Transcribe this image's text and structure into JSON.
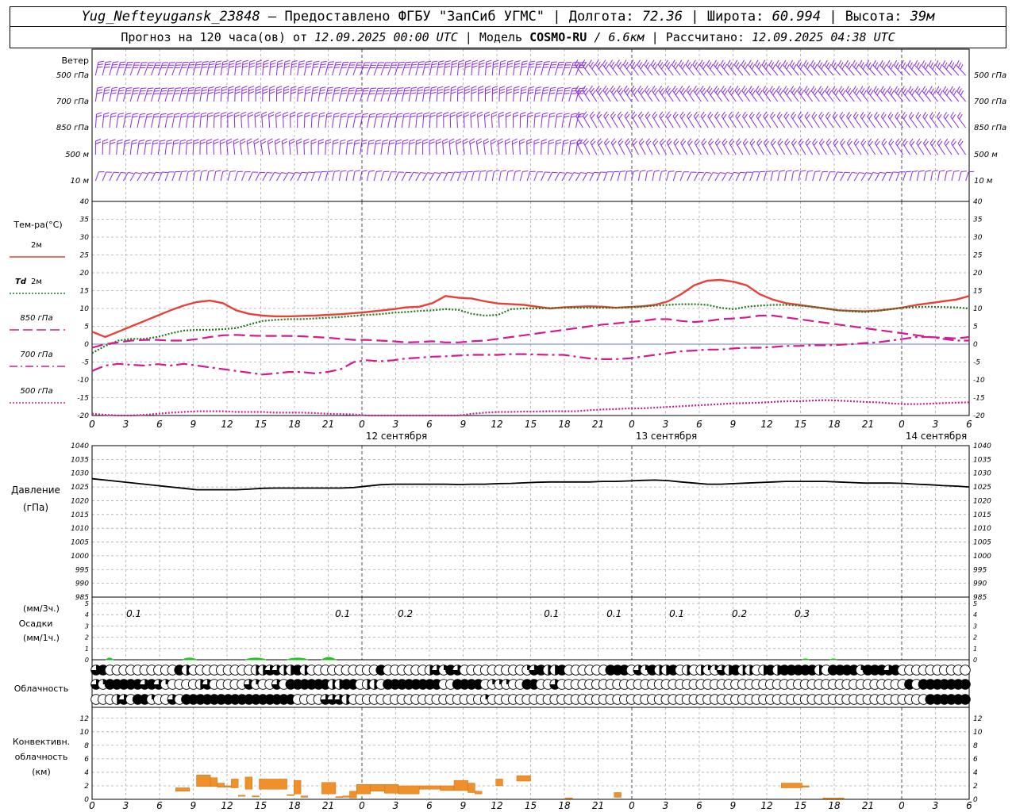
{
  "header": {
    "station": "Yug_Nefteyugansk_23848",
    "provider": "– Предоставлено ФГБУ \"ЗапСиб УГМС\"",
    "lon_label": "Долгота:",
    "lon_value": "72.36",
    "lat_label": "Широта:",
    "lat_value": "60.994",
    "alt_label": "Высота:",
    "alt_value": "39м",
    "forecast_prefix": "Прогноз на 120 часа(ов) от",
    "forecast_start": "12.09.2025 00:00 UTC",
    "model_label": "Модель",
    "model_name": "COSMO-RU",
    "model_res": "/ 6.6км",
    "calc_label": "Рассчитано:",
    "calc_time": "12.09.2025 04:38 UTC"
  },
  "hour_ticks": [
    "0",
    "3",
    "6",
    "9",
    "12",
    "15",
    "18",
    "21",
    "0",
    "3",
    "6",
    "9",
    "12",
    "15",
    "18",
    "21",
    "0",
    "3",
    "6",
    "9",
    "12",
    "15",
    "18",
    "21",
    "0",
    "3",
    "6"
  ],
  "day_labels": [
    {
      "index": 9,
      "text": "12 сентября"
    },
    {
      "index": 17,
      "text": "13 сентября"
    },
    {
      "index": 25,
      "text": "14 сентября"
    }
  ],
  "wind_panel": {
    "title": "Ветер",
    "levels": [
      "500 гПа",
      "700 гПа",
      "850 гПа",
      "500 м",
      "10 м"
    ],
    "barb_color": "#8a2be2"
  },
  "chart_data": [
    {
      "type": "line",
      "name": "temperature",
      "title": "Тем-ра(°C)",
      "x_hours": [
        0,
        3,
        6,
        9,
        12,
        15,
        18,
        21,
        24,
        27,
        30,
        33,
        36,
        39,
        42,
        45,
        48,
        51,
        54,
        57,
        60,
        63,
        66,
        69,
        72,
        75,
        78,
        81,
        84,
        87,
        90,
        93,
        96,
        99,
        102,
        105,
        108,
        111,
        114,
        117,
        120,
        123,
        126
      ],
      "ylim": [
        -20,
        40
      ],
      "yticks": [
        -20,
        -15,
        -10,
        -5,
        0,
        5,
        10,
        15,
        20,
        25,
        30,
        35,
        40
      ],
      "series": [
        {
          "name": "2м",
          "color": "#e8413a",
          "dash": "solid",
          "values": [
            3.5,
            2,
            3.5,
            5,
            6.5,
            8,
            9.5,
            10.8,
            11.8,
            12.2,
            11.5,
            9.5,
            8.5,
            8,
            7.8,
            7.8,
            7.9,
            8,
            8.2,
            8.4,
            8.7,
            9,
            9.4,
            9.8,
            10.3,
            10.5,
            11.5,
            13.5,
            13,
            12.8,
            12,
            11.4,
            11.2,
            11,
            10.5,
            10,
            10.3,
            10.5,
            10.6,
            10.5,
            10.2,
            10.4,
            10.6,
            11,
            12,
            14,
            16.5,
            17.8,
            18,
            17.5,
            16.5,
            14,
            12.5,
            11.5,
            11,
            10.5,
            10,
            9.5,
            9.3,
            9.2,
            9.4,
            9.8,
            10.3,
            11,
            11.5,
            12,
            12.5,
            13.5
          ]
        },
        {
          "name": "Td 2м",
          "color": "#1e7a1e",
          "dash": "dot",
          "values": [
            -2.5,
            -0.5,
            1,
            1.5,
            1.5,
            2,
            3,
            3.8,
            4,
            4,
            4.2,
            4.5,
            5.5,
            6.5,
            6.8,
            7,
            7,
            7.2,
            7.4,
            7.6,
            7.9,
            8.2,
            8.4,
            8.8,
            9,
            9.3,
            9.5,
            9.8,
            9.6,
            8.5,
            8,
            8.2,
            9.8,
            10,
            10,
            10.1,
            10.2,
            10.2,
            10.2,
            10.2,
            10.2,
            10.3,
            10.5,
            10.8,
            11,
            11.2,
            11.2,
            11,
            10.2,
            9.8,
            10.5,
            10.8,
            11,
            11,
            10.8,
            10.5,
            10,
            9.5,
            9.2,
            9,
            9.3,
            9.8,
            10.2,
            10.4,
            10.5,
            10.4,
            10.3,
            10
          ]
        },
        {
          "name": "850 гПа",
          "color": "#d21b8f",
          "dash": "longdash",
          "values": [
            -1,
            0,
            0.5,
            1,
            1.2,
            1.2,
            1,
            1,
            1.4,
            2,
            2.5,
            2.6,
            2.4,
            2.3,
            2.3,
            2.3,
            2.2,
            2,
            1.8,
            1.5,
            1.2,
            1.2,
            1,
            0.8,
            0.5,
            0.6,
            0.8,
            0.5,
            0.5,
            0.8,
            1,
            1.5,
            2,
            2.5,
            3,
            3.5,
            4,
            4.5,
            5,
            5.5,
            5.8,
            6.2,
            6.5,
            7,
            7,
            6.5,
            6.2,
            6.5,
            7,
            7.2,
            7.5,
            8,
            8,
            7.5,
            7,
            6.5,
            6,
            5.5,
            5,
            4.5,
            4,
            3.5,
            3,
            2.5,
            2,
            1.8,
            1.6,
            2
          ]
        },
        {
          "name": "700 гПа",
          "color": "#d21b8f",
          "dash": "dashdot",
          "values": [
            -7.5,
            -6,
            -5.5,
            -5.8,
            -6,
            -5.6,
            -6,
            -5.5,
            -6,
            -6.5,
            -7,
            -7.5,
            -8,
            -8.5,
            -8.2,
            -7.8,
            -7.8,
            -8.2,
            -7.8,
            -7,
            -5,
            -4.5,
            -4.8,
            -4.5,
            -4,
            -3.8,
            -3.5,
            -3.4,
            -3.2,
            -3,
            -3,
            -3,
            -2.8,
            -2.8,
            -2.9,
            -3,
            -3,
            -3.5,
            -4,
            -4.2,
            -4.2,
            -4,
            -3.5,
            -3,
            -2.5,
            -2,
            -1.8,
            -1.5,
            -1.5,
            -1.2,
            -1,
            -1,
            -0.8,
            -0.5,
            -0.5,
            -0.3,
            -0.3,
            -0.2,
            0,
            0.3,
            0.5,
            1,
            1.5,
            2,
            2,
            1.5,
            1,
            1
          ]
        },
        {
          "name": "500 гПа",
          "color": "#d21b8f",
          "dash": "dot",
          "values": [
            -19.5,
            -19.8,
            -20,
            -20,
            -19.8,
            -19.5,
            -19.2,
            -19,
            -18.8,
            -18.8,
            -18.8,
            -19,
            -19,
            -19,
            -19.2,
            -19.2,
            -19.2,
            -19.3,
            -19.5,
            -19.6,
            -19.7,
            -20,
            -20,
            -20,
            -20,
            -20,
            -20,
            -20,
            -20,
            -19.5,
            -19.2,
            -19,
            -19,
            -18.9,
            -18.9,
            -18.8,
            -18.8,
            -18.8,
            -18.5,
            -18.3,
            -18.2,
            -18,
            -18,
            -17.8,
            -17.6,
            -17.4,
            -17.2,
            -17,
            -16.8,
            -16.6,
            -16.5,
            -16.4,
            -16.2,
            -16,
            -16,
            -15.8,
            -15.7,
            -15.8,
            -16,
            -16.2,
            -16.3,
            -16.6,
            -16.8,
            -16.8,
            -16.7,
            -16.5,
            -16.4,
            -16.3
          ]
        }
      ]
    },
    {
      "type": "line",
      "name": "pressure",
      "title": "Давление",
      "ylabel": "(гПа)",
      "ylim": [
        985,
        1040
      ],
      "yticks": [
        985,
        990,
        995,
        1000,
        1005,
        1010,
        1015,
        1020,
        1025,
        1030,
        1035,
        1040
      ],
      "series": [
        {
          "name": "Давление",
          "color": "#000000",
          "values": [
            1028,
            1027.5,
            1027,
            1026.5,
            1026,
            1025.5,
            1025,
            1024.5,
            1024,
            1024,
            1024,
            1024,
            1024.2,
            1024.5,
            1024.6,
            1024.6,
            1024.6,
            1024.6,
            1024.6,
            1024.6,
            1024.8,
            1025.3,
            1025.8,
            1026,
            1026,
            1026,
            1026,
            1026,
            1025.9,
            1026,
            1026,
            1026.2,
            1026.3,
            1026.5,
            1026.7,
            1026.8,
            1026.8,
            1026.8,
            1026.8,
            1027,
            1027,
            1027.2,
            1027.4,
            1027.5,
            1027.3,
            1026.8,
            1026.4,
            1026,
            1026,
            1026.2,
            1026.4,
            1026.6,
            1026.8,
            1027,
            1027,
            1027,
            1027,
            1026.8,
            1026.6,
            1026.4,
            1026.4,
            1026.4,
            1026.3,
            1026,
            1025.8,
            1025.5,
            1025.3,
            1025
          ]
        }
      ]
    },
    {
      "type": "bar",
      "name": "precipitation",
      "ylabel": "Осадки",
      "units_3h": "(мм/3ч.)",
      "units_1h": "(мм/1ч.)",
      "ylim": [
        0,
        5
      ],
      "yticks": [
        0,
        1,
        2,
        3,
        4,
        5
      ],
      "color": "#22c022",
      "amount_labels_3h": [
        {
          "hour": 6,
          "text": "0.1"
        },
        {
          "hour": 36,
          "text": "0.1"
        },
        {
          "hour": 45,
          "text": "0.2"
        },
        {
          "hour": 66,
          "text": "0.1"
        },
        {
          "hour": 75,
          "text": "0.1"
        },
        {
          "hour": 84,
          "text": "0.1"
        },
        {
          "hour": 93,
          "text": "0.2"
        },
        {
          "hour": 102,
          "text": "0.3"
        }
      ],
      "hourly_bumps": [
        {
          "from": 6,
          "to": 9,
          "value": 0.3
        },
        {
          "from": 39,
          "to": 45,
          "value": 0.3
        },
        {
          "from": 66,
          "to": 75,
          "value": 0.3
        },
        {
          "from": 84,
          "to": 93,
          "value": 0.3
        },
        {
          "from": 99,
          "to": 105,
          "value": 0.4
        },
        {
          "from": 306,
          "to": 309,
          "value": 0.15
        },
        {
          "from": 318,
          "to": 321,
          "value": 0.15
        }
      ]
    },
    {
      "type": "bar",
      "name": "convective_cloud",
      "title": "Конвективн. облачность (км)",
      "ylim": [
        0,
        12
      ],
      "yticks": [
        0,
        2,
        4,
        6,
        8,
        10,
        12
      ],
      "color": "#f0902a",
      "segments": [
        {
          "from": 36,
          "to": 42,
          "bottom": 1.2,
          "top": 1.7
        },
        {
          "from": 45,
          "to": 51,
          "bottom": 1.9,
          "top": 3.6
        },
        {
          "from": 51,
          "to": 54,
          "bottom": 1.9,
          "top": 3.2
        },
        {
          "from": 54,
          "to": 57,
          "bottom": 1.8,
          "top": 2.4
        },
        {
          "from": 57,
          "to": 60,
          "bottom": 1.8,
          "top": 2.0
        },
        {
          "from": 60,
          "to": 63,
          "bottom": 1.7,
          "top": 3.0
        },
        {
          "from": 63,
          "to": 66,
          "bottom": 0.5,
          "top": 0.6
        },
        {
          "from": 66,
          "to": 69,
          "bottom": 1.5,
          "top": 3.3
        },
        {
          "from": 69,
          "to": 72,
          "bottom": 0.4,
          "top": 0.5
        },
        {
          "from": 72,
          "to": 84,
          "bottom": 1.5,
          "top": 3.0
        },
        {
          "from": 84,
          "to": 87,
          "bottom": 0.6,
          "top": 0.7
        },
        {
          "from": 87,
          "to": 90,
          "bottom": 0.8,
          "top": 2.8
        },
        {
          "from": 90,
          "to": 93,
          "bottom": 0.3,
          "top": 0.5
        },
        {
          "from": 99,
          "to": 105,
          "bottom": 0.8,
          "top": 2.5
        },
        {
          "from": 105,
          "to": 108,
          "bottom": 0.3,
          "top": 0.4
        },
        {
          "from": 108,
          "to": 111,
          "bottom": 0.3,
          "top": 0.5
        },
        {
          "from": 111,
          "to": 114,
          "bottom": 0.2,
          "top": 1.2
        },
        {
          "from": 114,
          "to": 120,
          "bottom": 0.8,
          "top": 2.2
        },
        {
          "from": 120,
          "to": 126,
          "bottom": 1.2,
          "top": 2.2
        },
        {
          "from": 126,
          "to": 132,
          "bottom": 0.9,
          "top": 2.2
        },
        {
          "from": 132,
          "to": 141,
          "bottom": 0.8,
          "top": 2.0
        },
        {
          "from": 141,
          "to": 150,
          "bottom": 1.5,
          "top": 2.0
        },
        {
          "from": 150,
          "to": 156,
          "bottom": 1.3,
          "top": 2.0
        },
        {
          "from": 156,
          "to": 162,
          "bottom": 1.3,
          "top": 2.8
        },
        {
          "from": 162,
          "to": 165,
          "bottom": 1.0,
          "top": 2.4
        },
        {
          "from": 165,
          "to": 168,
          "bottom": 0.8,
          "top": 1.2
        },
        {
          "from": 174,
          "to": 177,
          "bottom": 2.0,
          "top": 3.0
        },
        {
          "from": 183,
          "to": 189,
          "bottom": 2.7,
          "top": 3.5
        },
        {
          "from": 204,
          "to": 207,
          "bottom": 0.1,
          "top": 0.2
        },
        {
          "from": 225,
          "to": 228,
          "bottom": 0.3,
          "top": 1.0
        },
        {
          "from": 297,
          "to": 306,
          "bottom": 1.7,
          "top": 2.4
        },
        {
          "from": 306,
          "to": 309,
          "bottom": 1.8,
          "top": 2.0
        },
        {
          "from": 315,
          "to": 324,
          "bottom": 0.1,
          "top": 0.2
        }
      ]
    }
  ],
  "cloud_panel": {
    "title": "Облачность",
    "rows": [
      "345000000000420000000002233224200000000004000000231430000000001342240000004440314224020211324220242444442044441444340000000000003244444444",
      "314444434310000230000031003044444422440220444444440044440111004400300000000000000000000000000000000000000000000000000404444444444",
      "000230441003044444444444444440000333200000000000000000001000000000000000000000000000000000000000000000000000000000000000444444444"
    ]
  }
}
